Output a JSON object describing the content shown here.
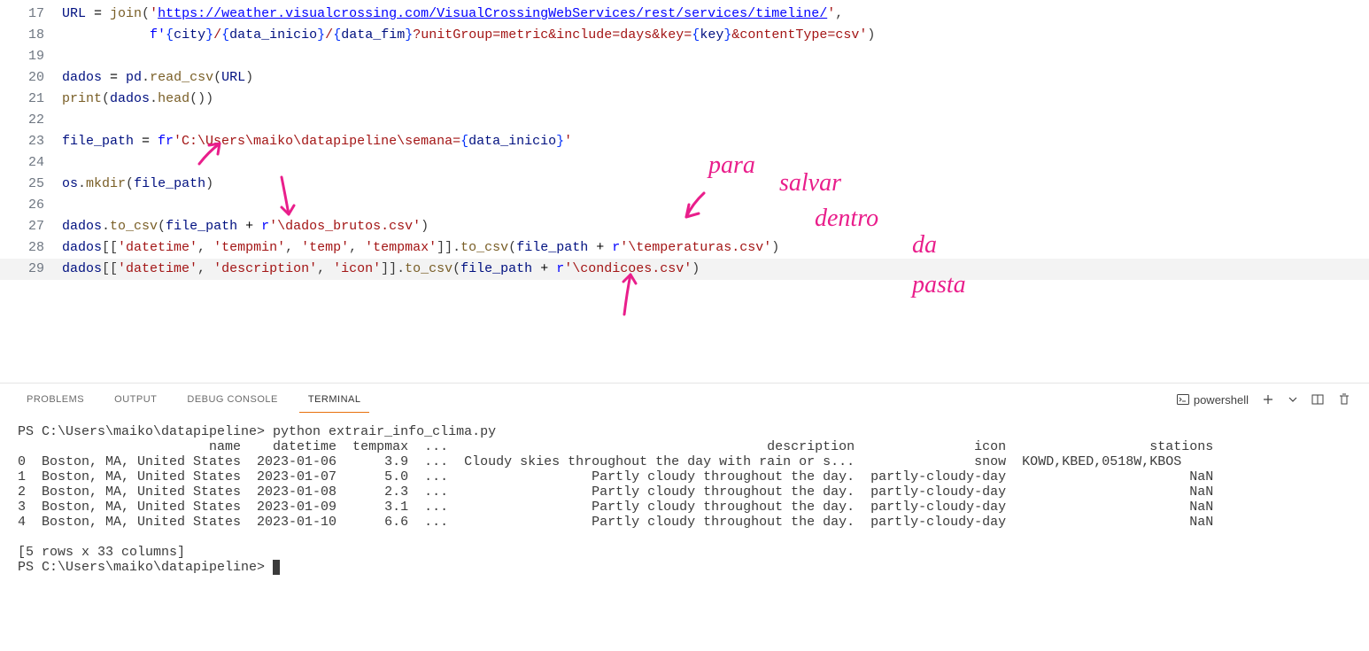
{
  "editor": {
    "lines": [
      {
        "num": 17,
        "tokens": [
          {
            "t": "URL ",
            "c": "tk-var"
          },
          {
            "t": "= ",
            "c": "tk-op"
          },
          {
            "t": "join",
            "c": "tk-fn"
          },
          {
            "t": "(",
            "c": ""
          },
          {
            "t": "'",
            "c": "tk-str"
          },
          {
            "t": "https://weather.visualcrossing.com/VisualCrossingWebServices/rest/services/timeline/",
            "c": "tk-link"
          },
          {
            "t": "'",
            "c": "tk-str"
          },
          {
            "t": ",",
            "c": ""
          }
        ]
      },
      {
        "num": 18,
        "tokens": [
          {
            "t": "           ",
            "c": ""
          },
          {
            "t": "f'",
            "c": "tk-kw"
          },
          {
            "t": "{",
            "c": "tk-brace"
          },
          {
            "t": "city",
            "c": "tk-var"
          },
          {
            "t": "}",
            "c": "tk-brace"
          },
          {
            "t": "/",
            "c": "tk-str"
          },
          {
            "t": "{",
            "c": "tk-brace"
          },
          {
            "t": "data_inicio",
            "c": "tk-var"
          },
          {
            "t": "}",
            "c": "tk-brace"
          },
          {
            "t": "/",
            "c": "tk-str"
          },
          {
            "t": "{",
            "c": "tk-brace"
          },
          {
            "t": "data_fim",
            "c": "tk-var"
          },
          {
            "t": "}",
            "c": "tk-brace"
          },
          {
            "t": "?unitGroup=metric&include=days&key=",
            "c": "tk-str"
          },
          {
            "t": "{",
            "c": "tk-brace"
          },
          {
            "t": "key",
            "c": "tk-var"
          },
          {
            "t": "}",
            "c": "tk-brace"
          },
          {
            "t": "&contentType=csv'",
            "c": "tk-str"
          },
          {
            "t": ")",
            "c": ""
          }
        ]
      },
      {
        "num": 19,
        "tokens": []
      },
      {
        "num": 20,
        "tokens": [
          {
            "t": "dados ",
            "c": "tk-var"
          },
          {
            "t": "= ",
            "c": "tk-op"
          },
          {
            "t": "pd",
            "c": "tk-var"
          },
          {
            "t": ".",
            "c": ""
          },
          {
            "t": "read_csv",
            "c": "tk-fn"
          },
          {
            "t": "(",
            "c": ""
          },
          {
            "t": "URL",
            "c": "tk-var"
          },
          {
            "t": ")",
            "c": ""
          }
        ]
      },
      {
        "num": 21,
        "tokens": [
          {
            "t": "print",
            "c": "tk-fn"
          },
          {
            "t": "(",
            "c": ""
          },
          {
            "t": "dados",
            "c": "tk-var"
          },
          {
            "t": ".",
            "c": ""
          },
          {
            "t": "head",
            "c": "tk-fn"
          },
          {
            "t": "())",
            "c": ""
          }
        ]
      },
      {
        "num": 22,
        "tokens": []
      },
      {
        "num": 23,
        "tokens": [
          {
            "t": "file_path ",
            "c": "tk-var"
          },
          {
            "t": "= ",
            "c": "tk-op"
          },
          {
            "t": "fr",
            "c": "tk-kw"
          },
          {
            "t": "'C:\\Users\\maiko\\datapipeline\\semana=",
            "c": "tk-str"
          },
          {
            "t": "{",
            "c": "tk-brace"
          },
          {
            "t": "data_inicio",
            "c": "tk-var"
          },
          {
            "t": "}",
            "c": "tk-brace"
          },
          {
            "t": "'",
            "c": "tk-str"
          }
        ]
      },
      {
        "num": 24,
        "tokens": []
      },
      {
        "num": 25,
        "tokens": [
          {
            "t": "os",
            "c": "tk-var"
          },
          {
            "t": ".",
            "c": ""
          },
          {
            "t": "mkdir",
            "c": "tk-fn"
          },
          {
            "t": "(",
            "c": ""
          },
          {
            "t": "file_path",
            "c": "tk-var"
          },
          {
            "t": ")",
            "c": ""
          }
        ]
      },
      {
        "num": 26,
        "tokens": []
      },
      {
        "num": 27,
        "tokens": [
          {
            "t": "dados",
            "c": "tk-var"
          },
          {
            "t": ".",
            "c": ""
          },
          {
            "t": "to_csv",
            "c": "tk-fn"
          },
          {
            "t": "(",
            "c": ""
          },
          {
            "t": "file_path ",
            "c": "tk-var"
          },
          {
            "t": "+ ",
            "c": "tk-op"
          },
          {
            "t": "r",
            "c": "tk-kw"
          },
          {
            "t": "'\\dados_brutos.csv'",
            "c": "tk-str"
          },
          {
            "t": ")",
            "c": ""
          }
        ]
      },
      {
        "num": 28,
        "tokens": [
          {
            "t": "dados",
            "c": "tk-var"
          },
          {
            "t": "[[",
            "c": ""
          },
          {
            "t": "'datetime'",
            "c": "tk-str"
          },
          {
            "t": ", ",
            "c": ""
          },
          {
            "t": "'tempmin'",
            "c": "tk-str"
          },
          {
            "t": ", ",
            "c": ""
          },
          {
            "t": "'temp'",
            "c": "tk-str"
          },
          {
            "t": ", ",
            "c": ""
          },
          {
            "t": "'tempmax'",
            "c": "tk-str"
          },
          {
            "t": "]].",
            "c": ""
          },
          {
            "t": "to_csv",
            "c": "tk-fn"
          },
          {
            "t": "(",
            "c": ""
          },
          {
            "t": "file_path ",
            "c": "tk-var"
          },
          {
            "t": "+ ",
            "c": "tk-op"
          },
          {
            "t": "r",
            "c": "tk-kw"
          },
          {
            "t": "'\\temperaturas.csv'",
            "c": "tk-str"
          },
          {
            "t": ")",
            "c": ""
          }
        ]
      },
      {
        "num": 29,
        "hl": true,
        "tokens": [
          {
            "t": "dados",
            "c": "tk-var"
          },
          {
            "t": "[[",
            "c": ""
          },
          {
            "t": "'datetime'",
            "c": "tk-str"
          },
          {
            "t": ", ",
            "c": ""
          },
          {
            "t": "'description'",
            "c": "tk-str"
          },
          {
            "t": ", ",
            "c": ""
          },
          {
            "t": "'icon'",
            "c": "tk-str"
          },
          {
            "t": "]].",
            "c": ""
          },
          {
            "t": "to_csv",
            "c": "tk-fn"
          },
          {
            "t": "(",
            "c": ""
          },
          {
            "t": "file_path ",
            "c": "tk-var"
          },
          {
            "t": "+ ",
            "c": "tk-op"
          },
          {
            "t": "r",
            "c": "tk-kw"
          },
          {
            "t": "'\\condicoes.csv'",
            "c": "tk-str"
          },
          {
            "t": ")",
            "c": ""
          }
        ]
      }
    ]
  },
  "annotation_text": "para salvar dentro da pasta",
  "panel": {
    "tabs": {
      "problems": "PROBLEMS",
      "output": "OUTPUT",
      "debug": "DEBUG CONSOLE",
      "terminal": "TERMINAL"
    },
    "shell_label": "powershell"
  },
  "terminal": {
    "prompt1": "PS C:\\Users\\maiko\\datapipeline> ",
    "command": "python extrair_info_clima.py",
    "header": "                        name    datetime  tempmax  ...                                        description               icon                  stations",
    "rows": [
      "0  Boston, MA, United States  2023-01-06      3.9  ...  Cloudy skies throughout the day with rain or s...               snow  KOWD,KBED,0518W,KBOS",
      "1  Boston, MA, United States  2023-01-07      5.0  ...                  Partly cloudy throughout the day.  partly-cloudy-day                       NaN",
      "2  Boston, MA, United States  2023-01-08      2.3  ...                  Partly cloudy throughout the day.  partly-cloudy-day                       NaN",
      "3  Boston, MA, United States  2023-01-09      3.1  ...                  Partly cloudy throughout the day.  partly-cloudy-day                       NaN",
      "4  Boston, MA, United States  2023-01-10      6.6  ...                  Partly cloudy throughout the day.  partly-cloudy-day                       NaN"
    ],
    "footer1": "",
    "footer2": "[5 rows x 33 columns]",
    "prompt2": "PS C:\\Users\\maiko\\datapipeline> "
  }
}
